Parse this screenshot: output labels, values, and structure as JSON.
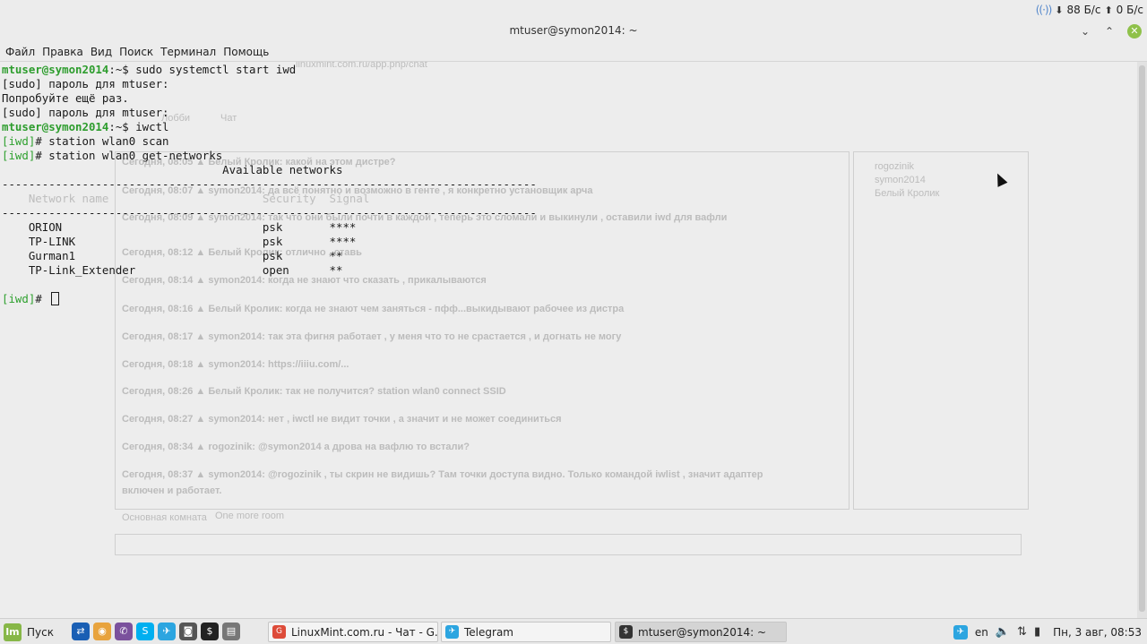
{
  "system_bar": {
    "download": "88 Б/с",
    "upload": "0 Б/с"
  },
  "window": {
    "title": "mtuser@symon2014: ~",
    "menu": [
      "Файл",
      "Правка",
      "Вид",
      "Поиск",
      "Терминал",
      "Помощь"
    ]
  },
  "terminal": {
    "lines": [
      {
        "prompt": "mtuser@symon2014",
        "path": ":~$ ",
        "text": "sudo systemctl start iwd"
      },
      {
        "text": "[sudo] пароль для mtuser:"
      },
      {
        "text": "Попробуйте ещё раз."
      },
      {
        "text": "[sudo] пароль для mtuser:"
      },
      {
        "prompt": "mtuser@symon2014",
        "path": ":~$ ",
        "text": "iwctl"
      },
      {
        "iwd": "[iwd]",
        "text": "# station wlan0 scan"
      },
      {
        "iwd": "[iwd]",
        "text": "# station wlan0 get-networks"
      },
      {
        "text": "                                 Available networks"
      },
      {
        "text": "--------------------------------------------------------------------------------"
      },
      {
        "hdr": "    Network name                       Security  Signal"
      },
      {
        "text": "--------------------------------------------------------------------------------"
      },
      {
        "text": "    ORION                              psk       ****"
      },
      {
        "text": "    TP-LINK                            psk       ****"
      },
      {
        "text": "    Gurman1                            psk       **"
      },
      {
        "text": "    TP-Link_Extender                   open      **"
      },
      {
        "text": ""
      },
      {
        "iwd": "[iwd]",
        "text": "# ",
        "cursor": true
      }
    ]
  },
  "background_chat": {
    "address": "linuxmint.com.ru/app.php/chat",
    "tabs": [
      "Лобби",
      "Чат"
    ],
    "users": [
      "rogozinik",
      "symon2014",
      "Белый Кролик"
    ],
    "messages": [
      "Сегодня, 08:05 ▲ Белый Кролик: какой на этом дистре?",
      "Сегодня, 08:07 ▲ symon2014: да всё понятно и возможно в генте , я конкретно установщик арча",
      "Сегодня, 08:09 ▲ symon2014: так что они были почти в каждой , теперь это сломали и выкинули , оставили iwd для вафли",
      "Сегодня, 08:12 ▲ Белый Кролик: отлично , ставь",
      "Сегодня, 08:14 ▲ symon2014: когда не знают что сказать , прикалываются",
      "Сегодня, 08:16 ▲ Белый Кролик: когда не знают чем заняться - пфф...выкидывают рабочее из дистра",
      "Сегодня, 08:17 ▲ symon2014: так эта фигня работает , у меня что то не срастается , и догнать не могу",
      "Сегодня, 08:18 ▲ symon2014: https://iiiu.com/...",
      "Сегодня, 08:26 ▲ Белый Кролик: так не получится? station wlan0 connect SSID",
      "Сегодня, 08:27 ▲ symon2014: нет , iwctl не видит точки , а значит и не может соединиться",
      "Сегодня, 08:34 ▲ rogozinik: @symon2014 а дрова на вафлю то встали?",
      "Сегодня, 08:37 ▲ symon2014: @rogozinik , ты скрин не видишь? Там точки доступа видно. Только командой iwlist , значит адаптер",
      "включен и работает."
    ],
    "room_label": "Основная комната",
    "room_hint": "One more room"
  },
  "taskbar": {
    "start_label": "Пуск",
    "tasks": [
      {
        "label": "LinuxMint.com.ru - Чат - G...",
        "color": "#dd4b39",
        "glyph": "G"
      },
      {
        "label": "Telegram",
        "color": "#2ca5e0",
        "glyph": "✈"
      },
      {
        "label": "mtuser@symon2014: ~",
        "color": "#333333",
        "glyph": "$"
      }
    ],
    "lang": "en",
    "clock": "Пн, 3 авг, 08:53"
  }
}
